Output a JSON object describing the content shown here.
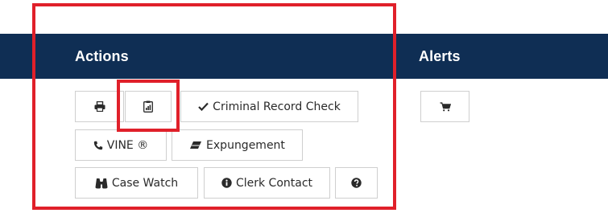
{
  "header": {
    "actions_title": "Actions",
    "alerts_title": "Alerts"
  },
  "actions": {
    "print": {
      "icon": "print-icon"
    },
    "report": {
      "icon": "clipboard-report-icon"
    },
    "criminal_record_check": {
      "icon": "checkmark-icon",
      "label": "Criminal Record Check"
    },
    "vine": {
      "icon": "phone-icon",
      "label": "VINE ®"
    },
    "expungement": {
      "icon": "eraser-icon",
      "label": "Expungement"
    },
    "case_watch": {
      "icon": "binoculars-icon",
      "label": "Case Watch"
    },
    "clerk_contact": {
      "icon": "info-circle-icon",
      "label": "Clerk Contact"
    },
    "help": {
      "icon": "question-circle-icon"
    }
  },
  "alerts": {
    "cart": {
      "icon": "shopping-cart-icon"
    }
  },
  "colors": {
    "header_bg": "#0f2e54",
    "highlight": "#e0202a",
    "button_border": "#cfcfcf",
    "text": "#2a2a2a"
  }
}
